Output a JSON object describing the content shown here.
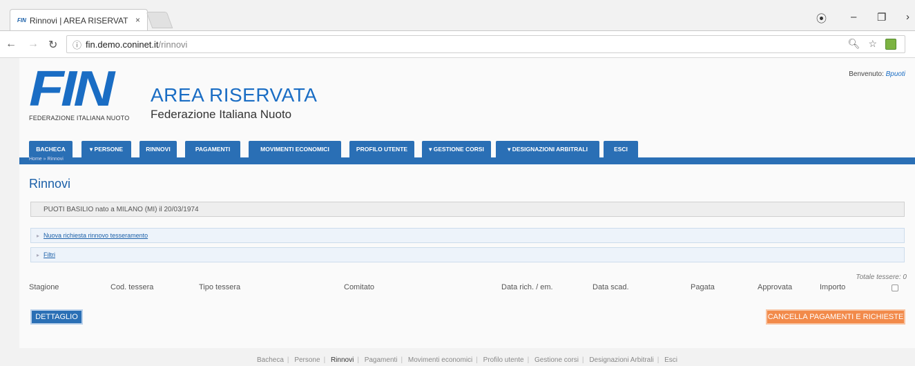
{
  "browser": {
    "tab_favicon": "FIN",
    "tab_title": "Rinnovi | AREA RISERVAT",
    "tab_close": "×",
    "url_host": "fin.demo.coninet.it",
    "url_path": "/rinnovi"
  },
  "header": {
    "logo_text": "FIN",
    "logo_subtitle": "FEDERAZIONE ITALIANA NUOTO",
    "area_title": "AREA RISERVATA",
    "org_name": "Federazione Italiana Nuoto",
    "welcome_label": "Benvenuto:",
    "welcome_user": "Bpuoti"
  },
  "nav": {
    "tabs": [
      {
        "label": "BACHECA"
      },
      {
        "label": "▾ PERSONE"
      },
      {
        "label": "RINNOVI"
      },
      {
        "label": "PAGAMENTI"
      },
      {
        "label": "MOVIMENTI ECONOMICI"
      },
      {
        "label": "PROFILO UTENTE"
      },
      {
        "label": "▾ GESTIONE CORSI"
      },
      {
        "label": "▾ DESIGNAZIONI ARBITRALI"
      },
      {
        "label": "ESCI"
      }
    ],
    "breadcrumb": "Home » Rinnovi"
  },
  "main": {
    "title": "Rinnovi",
    "person_info": "PUOTI BASILIO nato a MILANO (MI) il 20/03/1974",
    "panel_new": "Nuova richiesta rinnovo tesseramento",
    "panel_filters": "Filtri",
    "totale_label": "Totale tessere: 0",
    "columns": [
      "Stagione",
      "Cod. tessera",
      "Tipo tessera",
      "Comitato",
      "Data rich. / em.",
      "Data scad.",
      "Pagata",
      "Approvata",
      "Importo"
    ],
    "btn_dettaglio": "DETTAGLIO",
    "btn_cancella": "CANCELLA PAGAMENTI E RICHIESTE"
  },
  "footer": {
    "links": [
      "Bacheca",
      "Persone",
      "Rinnovi",
      "Pagamenti",
      "Movimenti economici",
      "Profilo utente",
      "Gestione corsi",
      "Designazioni Arbitrali",
      "Esci"
    ]
  },
  "colors": {
    "brand_blue": "#2a6fb5",
    "logo_blue": "#1a6dc4",
    "cancel_orange": "#f28a4a"
  }
}
